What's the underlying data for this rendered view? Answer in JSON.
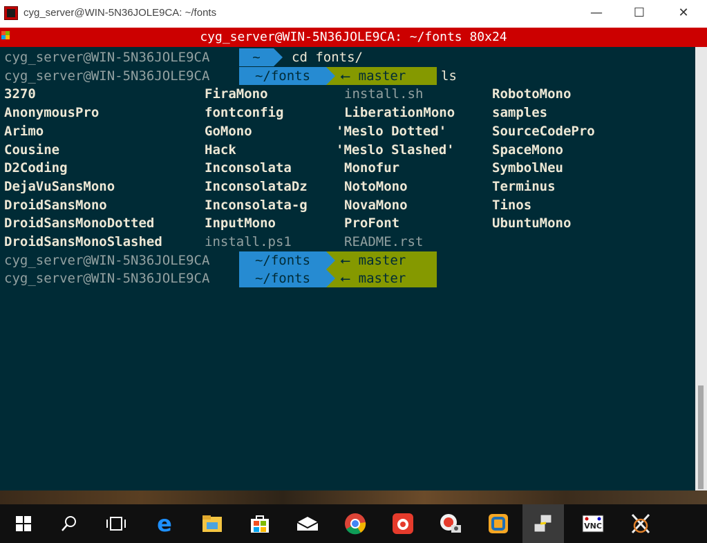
{
  "window": {
    "title": "cyg_server@WIN-5N36JOLE9CA: ~/fonts",
    "minimize": "—",
    "maximize": "☐",
    "close": "✕"
  },
  "inner_title": "cyg_server@WIN-5N36JOLE9CA: ~/fonts 80x24",
  "terminal": {
    "prompt_user": "cyg_server@WIN-5N36JOLE9CA",
    "lines": [
      {
        "dir": "~",
        "branch": "",
        "cmd": "cd fonts/"
      },
      {
        "dir": "~/fonts",
        "branch": "master",
        "cmd": "ls"
      },
      {
        "dir": "~/fonts",
        "branch": "master",
        "cmd": ""
      },
      {
        "dir": "~/fonts",
        "branch": "master",
        "cmd": ""
      }
    ],
    "branch_glyph": "⭠",
    "listing": {
      "col1": [
        "3270",
        "AnonymousPro",
        "Arimo",
        "Cousine",
        "D2Coding",
        "DejaVuSansMono",
        "DroidSansMono",
        "DroidSansMonoDotted",
        "DroidSansMonoSlashed"
      ],
      "col2": [
        "FiraMono",
        "fontconfig",
        "GoMono",
        "Hack",
        "Inconsolata",
        "InconsolataDz",
        "Inconsolata-g",
        "InputMono",
        "install.ps1"
      ],
      "col3": [
        "install.sh",
        "LiberationMono",
        "'Meslo Dotted'",
        "'Meslo Slashed'",
        "Monofur",
        "NotoMono",
        "NovaMono",
        "ProFont",
        "README.rst"
      ],
      "col4": [
        "RobotoMono",
        "samples",
        "SourceCodePro",
        "SpaceMono",
        "SymbolNeu",
        "Terminus",
        "Tinos",
        "UbuntuMono"
      ],
      "files": [
        "install.ps1",
        "install.sh",
        "README.rst"
      ]
    }
  },
  "taskbar": {
    "items": [
      "start-icon",
      "search-icon",
      "task-view-icon",
      "edge-icon",
      "file-explorer-icon",
      "store-icon",
      "mail-icon",
      "chrome-icon",
      "screenshot-app-icon",
      "media-app-icon",
      "vmware-icon",
      "network-app-icon",
      "vnc-icon",
      "xserver-icon"
    ]
  },
  "colors": {
    "base03": "#002b36",
    "blue": "#268bd2",
    "green": "#859900",
    "base1": "#93a1a1",
    "red": "#cc0000"
  }
}
